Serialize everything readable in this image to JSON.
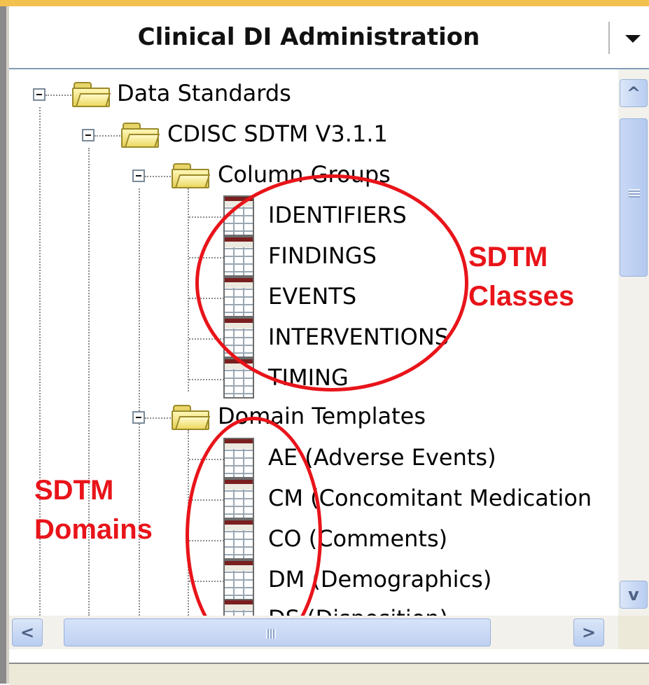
{
  "header": {
    "title": "Clinical DI Administration"
  },
  "tree": {
    "nodes": [
      {
        "label": "Data Standards",
        "icon": "folder-icon",
        "expanded": true
      },
      {
        "label": "CDISC SDTM V3.1.1",
        "icon": "folder-icon",
        "expanded": true
      },
      {
        "label": "Column Groups",
        "icon": "folder-icon",
        "expanded": true
      },
      {
        "label": "IDENTIFIERS",
        "icon": "table-icon"
      },
      {
        "label": "FINDINGS",
        "icon": "table-icon"
      },
      {
        "label": "EVENTS",
        "icon": "table-icon"
      },
      {
        "label": "INTERVENTIONS",
        "icon": "table-icon"
      },
      {
        "label": "TIMING",
        "icon": "table-icon"
      },
      {
        "label": "Domain Templates",
        "icon": "folder-icon",
        "expanded": true
      },
      {
        "label": "AE (Adverse Events)",
        "icon": "table-icon"
      },
      {
        "label": "CM (Concomitant Medication",
        "icon": "table-icon"
      },
      {
        "label": "CO (Comments)",
        "icon": "table-icon"
      },
      {
        "label": "DM (Demographics)",
        "icon": "table-icon"
      },
      {
        "label": "DS (Disposition)",
        "icon": "table-icon"
      }
    ]
  },
  "annotations": {
    "classes": {
      "line1": "SDTM",
      "line2": "Classes"
    },
    "domains": {
      "line1": "SDTM",
      "line2": "Domains"
    },
    "color": "#e8141a"
  },
  "scrollbars": {
    "up_arrow": "^",
    "down_arrow": "v",
    "left_arrow": "<",
    "right_arrow": ">"
  },
  "colors": {
    "accent": "#f2c14e",
    "scroll_blue": "#b9cdf0"
  }
}
